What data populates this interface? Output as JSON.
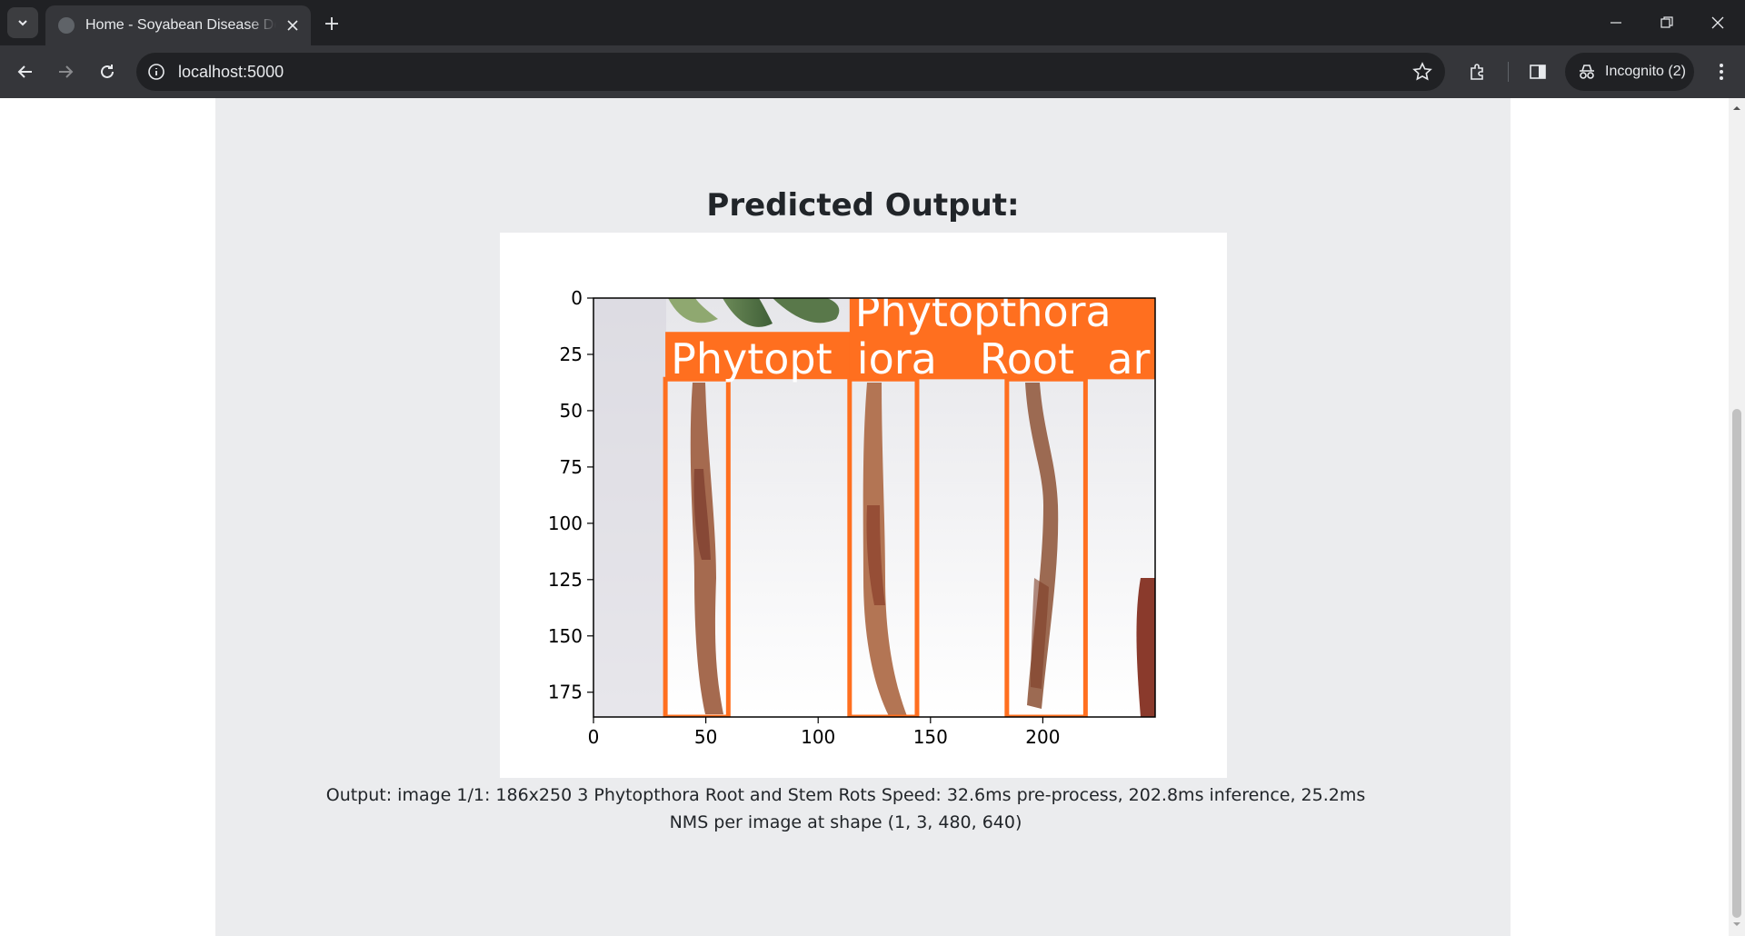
{
  "browser": {
    "tab_title": "Home - Soyabean Disease Detection",
    "url": "localhost:5000",
    "incognito_label": "Incognito (2)",
    "colors": {
      "titlebar": "#202124",
      "toolbar": "#35363a",
      "text": "#e8eaed"
    }
  },
  "page": {
    "heading": "Predicted Output:",
    "output_text": "Output: image 1/1: 186x250 3 Phytopthora Root and Stem Rots Speed: 32.6ms pre-process, 202.8ms inference, 25.2ms NMS per image at shape (1, 3, 480, 640)",
    "background": "#ebecee"
  },
  "figure": {
    "x_ticks": [
      "0",
      "50",
      "100",
      "150",
      "200"
    ],
    "y_ticks": [
      "0",
      "25",
      "50",
      "75",
      "100",
      "125",
      "150",
      "175"
    ],
    "x_range": [
      0,
      250
    ],
    "y_range": [
      186,
      0
    ],
    "box_color": "#ff6f1f",
    "detections": [
      {
        "label": "Phytopthora Root and Stem Rots",
        "x0": 32,
        "x1": 60,
        "y0": 36,
        "y1": 186
      },
      {
        "label": "Phytopthora Root and Stem Rots",
        "x0": 114,
        "x1": 144,
        "y0": 36,
        "y1": 186
      },
      {
        "label": "Phytopthora Root and Stem Rots",
        "x0": 184,
        "x1": 219,
        "y0": 36,
        "y1": 186
      }
    ],
    "label_texts": [
      "Phytopthora",
      "Phytopt",
      "iora",
      "Root",
      "ar"
    ]
  }
}
